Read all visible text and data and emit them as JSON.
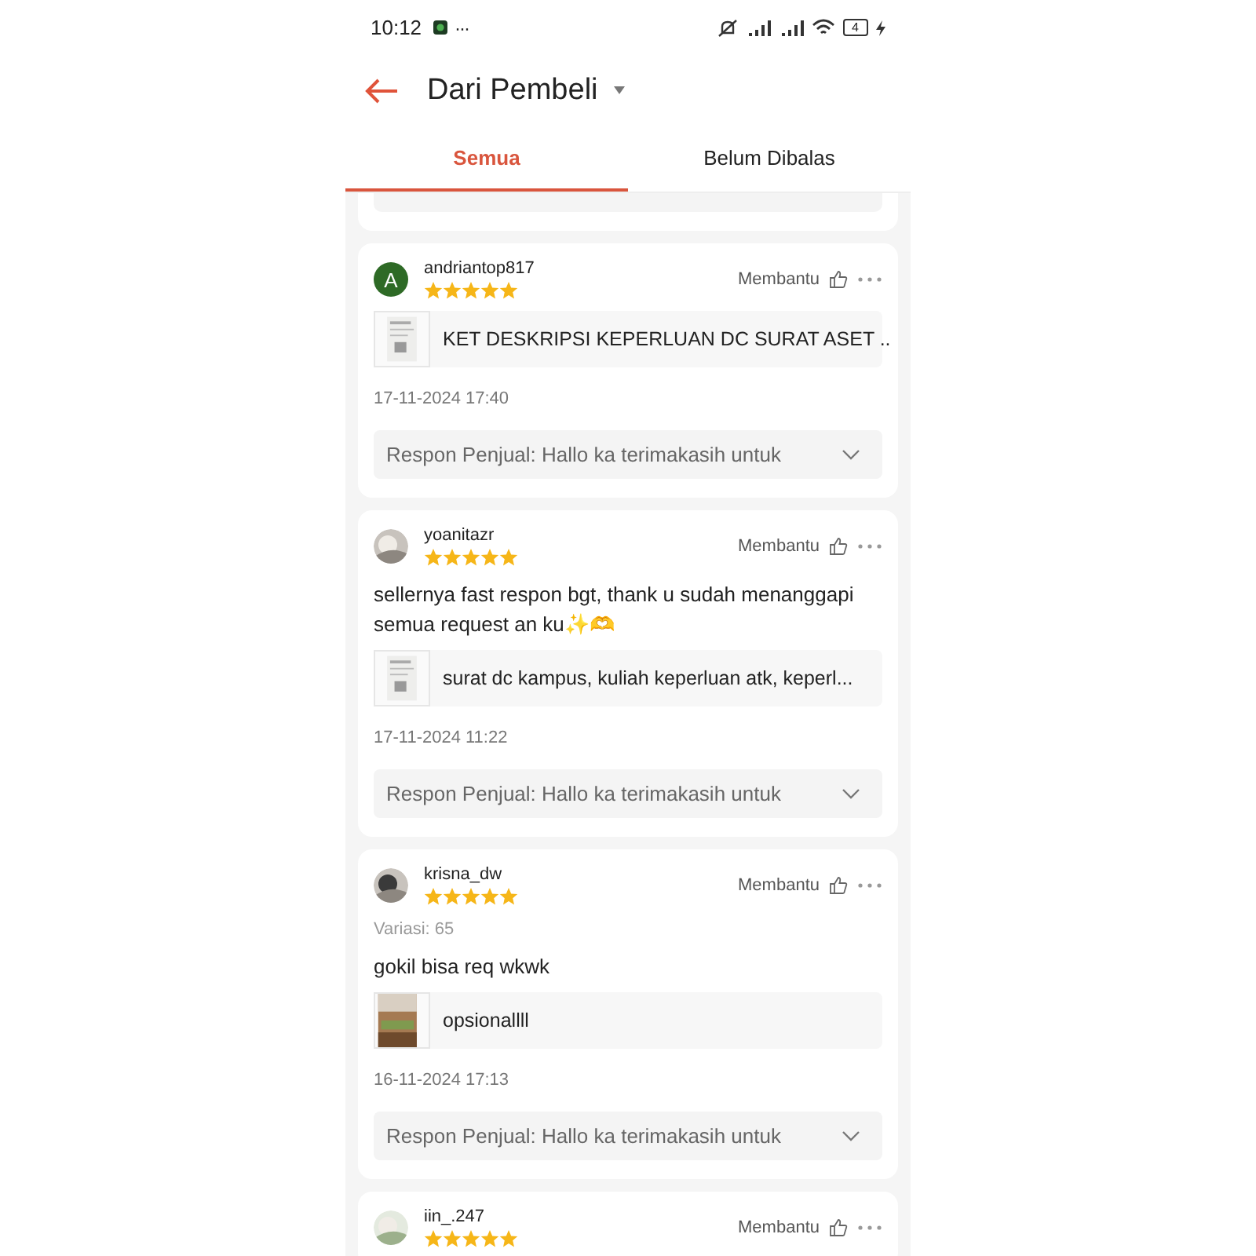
{
  "status_bar": {
    "time": "10:12",
    "more": "···",
    "battery": "4"
  },
  "header": {
    "title": "Dari Pembeli"
  },
  "tabs": [
    {
      "label": "Semua",
      "selected": true
    },
    {
      "label": "Belum Dibalas",
      "selected": false
    }
  ],
  "reviews": [
    {
      "user": "andriantop817",
      "avatar": {
        "kind": "letter",
        "letter": "A"
      },
      "stars": 5,
      "helpful": "Membantu",
      "product": "KET DESKRIPSI KEPERLUAN DC SURAT ASET ..",
      "thumbnail": {
        "kind": "document"
      },
      "date": "17-11-2024 17:40",
      "response": "Respon Penjual: Hallo ka terimakasih untuk"
    },
    {
      "user": "yoanitazr",
      "stars": 5,
      "helpful": "Membantu",
      "comment": "sellernya fast respon bgt, thank u sudah menanggapi semua request an ku✨🫶",
      "product": "surat dc kampus, kuliah keperluan atk, keperl...",
      "thumbnail": {
        "kind": "document"
      },
      "date": "17-11-2024 11:22",
      "response": "Respon Penjual: Hallo ka terimakasih untuk"
    },
    {
      "user": "krisna_dw",
      "stars": 5,
      "helpful": "Membantu",
      "variation": "Variasi: 65",
      "comment": "gokil bisa req wkwk",
      "product": "opsionallll",
      "date": "16-11-2024 17:13",
      "response": "Respon Penjual: Hallo ka terimakasih untuk"
    },
    {
      "user": "iin_.247",
      "stars": 5,
      "helpful": "Membantu"
    }
  ]
}
